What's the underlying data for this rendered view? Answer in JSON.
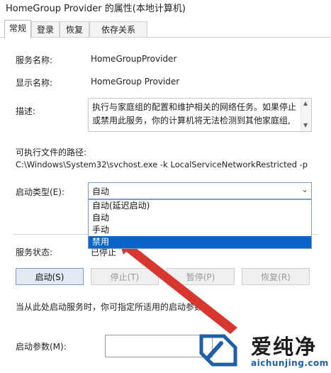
{
  "window": {
    "title": "HomeGroup Provider 的属性(本地计算机)"
  },
  "tabs": [
    {
      "label": "常规",
      "active": true
    },
    {
      "label": "登录",
      "active": false
    },
    {
      "label": "恢复",
      "active": false
    },
    {
      "label": "依存关系",
      "active": false
    }
  ],
  "general": {
    "service_name_label": "服务名称:",
    "service_name_value": "HomeGroupProvider",
    "display_name_label": "显示名称:",
    "display_name_value": "HomeGroup Provider",
    "description_label": "描述:",
    "description_value": "执行与家庭组的配置和维护相关的网络任务。如果停止或禁用此服务，你的计算机将无法检测到其他家庭组,",
    "exe_path_label": "可执行文件的路径:",
    "exe_path_value": "C:\\Windows\\System32\\svchost.exe -k LocalServiceNetworkRestricted -p",
    "startup_type_label": "启动类型(E):",
    "startup_type_value": "自动",
    "startup_options": [
      "自动(延迟启动)",
      "自动",
      "手动",
      "禁用"
    ],
    "startup_highlighted": "禁用",
    "status_label": "服务状态:",
    "status_value": "已停止",
    "start_button": "启动(S)",
    "stop_button": "停止(T)",
    "pause_button": "暂停(P)",
    "resume_button": "恢复(R)",
    "hint_text": "当从此处启动服务时，你可指定所适用的启动参数。",
    "params_label": "启动参数(M):",
    "params_value": ""
  },
  "watermark": {
    "name": "爱纯净",
    "url": "aichunjing.com"
  },
  "colors": {
    "selection": "#0a64c8",
    "arrow": "#d8372f",
    "watermark_blue": "#1e5fa8"
  }
}
